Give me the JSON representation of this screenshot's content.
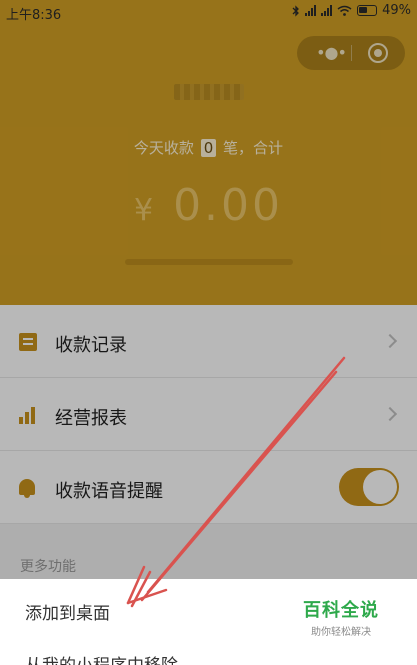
{
  "status_bar": {
    "time": "上午8:36",
    "battery_percent": "49%",
    "icons": [
      "bluetooth-icon",
      "signal-icon",
      "signal-icon",
      "wifi-icon",
      "battery-icon"
    ]
  },
  "capsule": {
    "more_icon": "more-dots-icon",
    "close_icon": "target-close-icon"
  },
  "header": {
    "count_prefix": "今天收款",
    "count_value": "0",
    "count_suffix": "笔，合计",
    "currency": "¥",
    "amount": "0.00"
  },
  "menu": {
    "items": [
      {
        "label": "收款记录",
        "icon": "document-icon"
      },
      {
        "label": "经营报表",
        "icon": "bar-chart-icon"
      },
      {
        "label": "收款语音提醒",
        "icon": "bell-icon",
        "toggle_on": true
      }
    ]
  },
  "more": {
    "label": "更多功能"
  },
  "sheet": {
    "option1": "添加到桌面",
    "option2": "从我的小程序中移除"
  },
  "watermark": {
    "title": "百科全说",
    "subtitle": "助你轻松解决"
  },
  "colors": {
    "header_bg": "#d2a024",
    "accent": "#c8921c",
    "arrow": "#d9534f",
    "watermark_green": "#2ea94b"
  }
}
